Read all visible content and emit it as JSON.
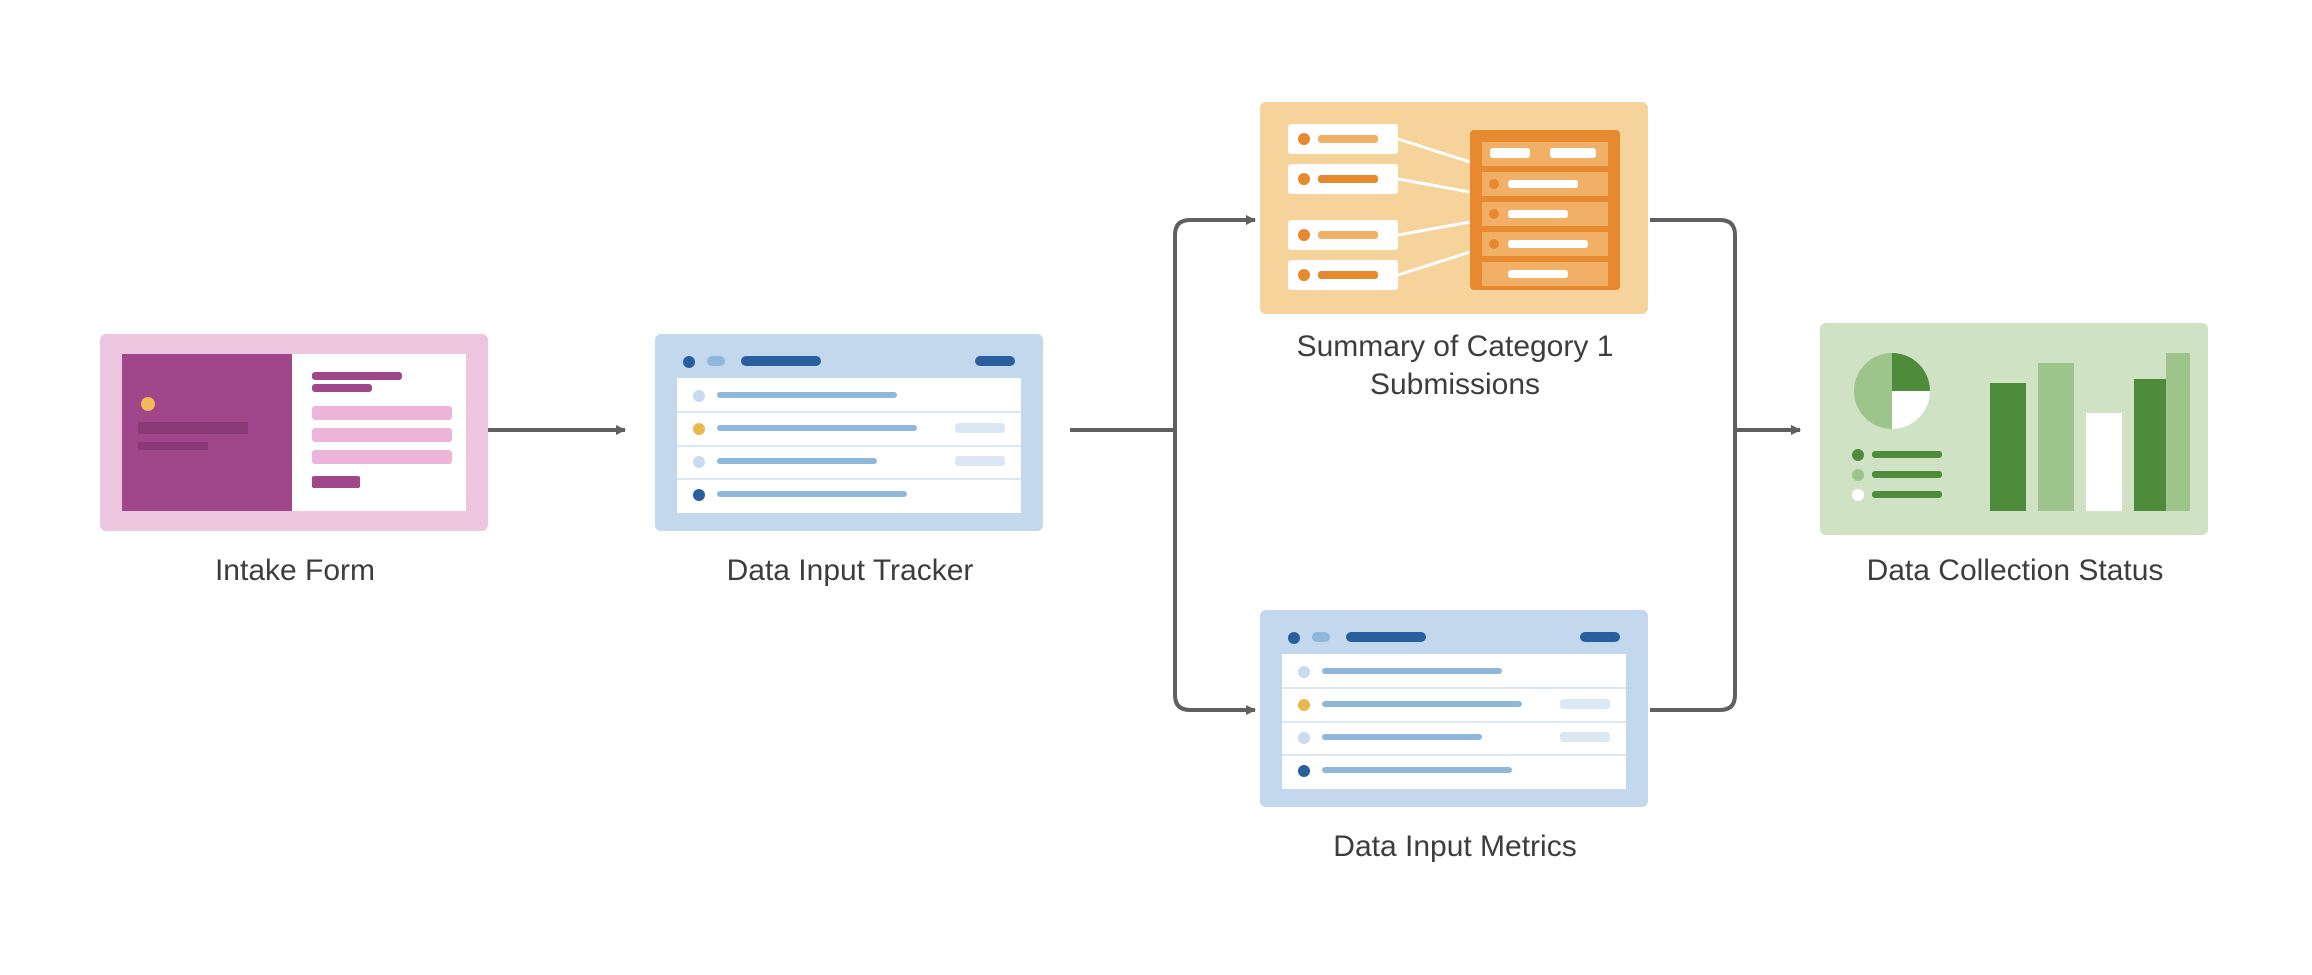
{
  "nodes": {
    "intake_form": {
      "label": "Intake Form"
    },
    "data_tracker": {
      "label": "Data Input Tracker"
    },
    "summary": {
      "label": "Summary of Category 1 Submissions"
    },
    "data_metrics": {
      "label": "Data Input Metrics"
    },
    "collection": {
      "label": "Data Collection Status"
    }
  },
  "edges": [
    [
      "intake_form",
      "data_tracker"
    ],
    [
      "data_tracker",
      "summary"
    ],
    [
      "data_tracker",
      "data_metrics"
    ],
    [
      "summary",
      "collection"
    ],
    [
      "data_metrics",
      "collection"
    ]
  ],
  "colors": {
    "arrow": "#606060",
    "pink_bg": "#eec5df",
    "pink_dark": "#a0468a",
    "pink_light": "#edb4d9",
    "blue_bg": "#c3d8ec",
    "blue_dark": "#2a5f9e",
    "blue_mid": "#8fb7dc",
    "orange_bg": "#f5d39a",
    "orange_dark": "#e6892f",
    "orange_mid": "#f2b066",
    "green_bg": "#cfe3c4",
    "green_dark": "#4e8b3b",
    "green_mid": "#9dc48a"
  }
}
